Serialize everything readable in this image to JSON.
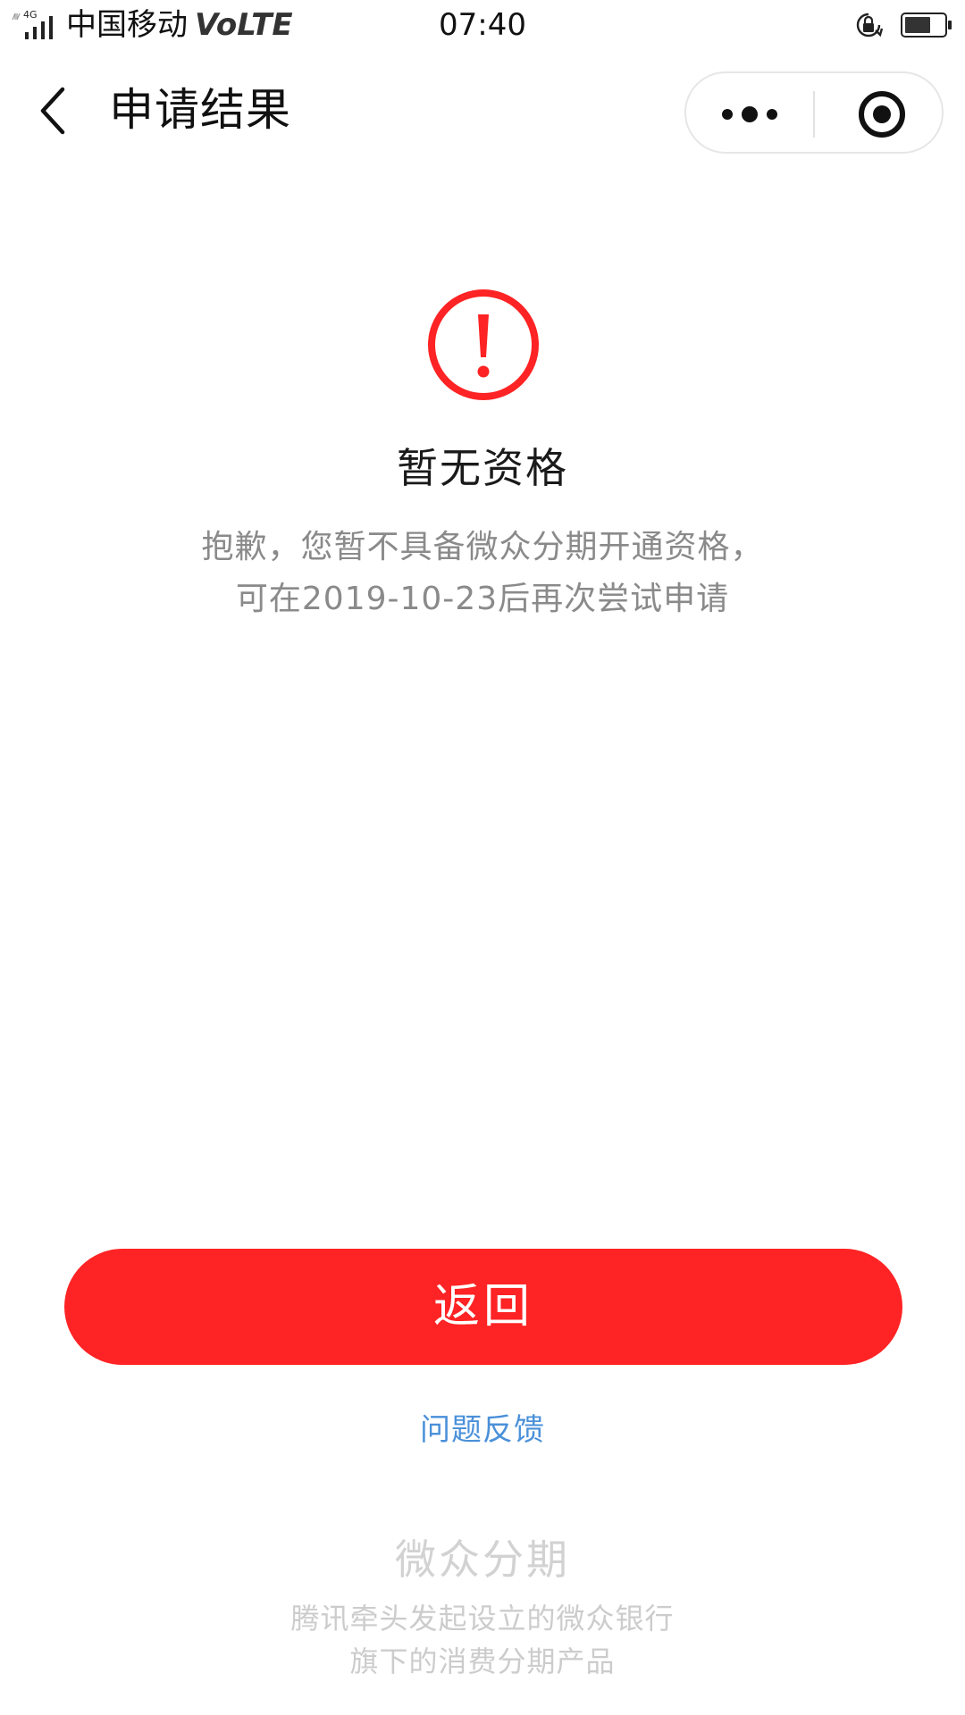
{
  "status_bar": {
    "network": "4G",
    "carrier": "中国移动",
    "volte": "VoLTE",
    "time": "07:40"
  },
  "nav": {
    "title": "申请结果"
  },
  "result": {
    "icon": "exclamation-circle-icon",
    "title": "暂无资格",
    "description": "抱歉，您暂不具备微众分期开通资格，可在2019-10-23后再次尝试申请"
  },
  "actions": {
    "return_label": "返回",
    "feedback_label": "问题反馈"
  },
  "footer": {
    "brand": "微众分期",
    "description_line1": "腾讯牵头发起设立的微众银行",
    "description_line2": "旗下的消费分期产品"
  },
  "colors": {
    "accent_red": "#fe2324",
    "link_blue": "#4a90d9",
    "muted_text": "#8a8a8a"
  }
}
